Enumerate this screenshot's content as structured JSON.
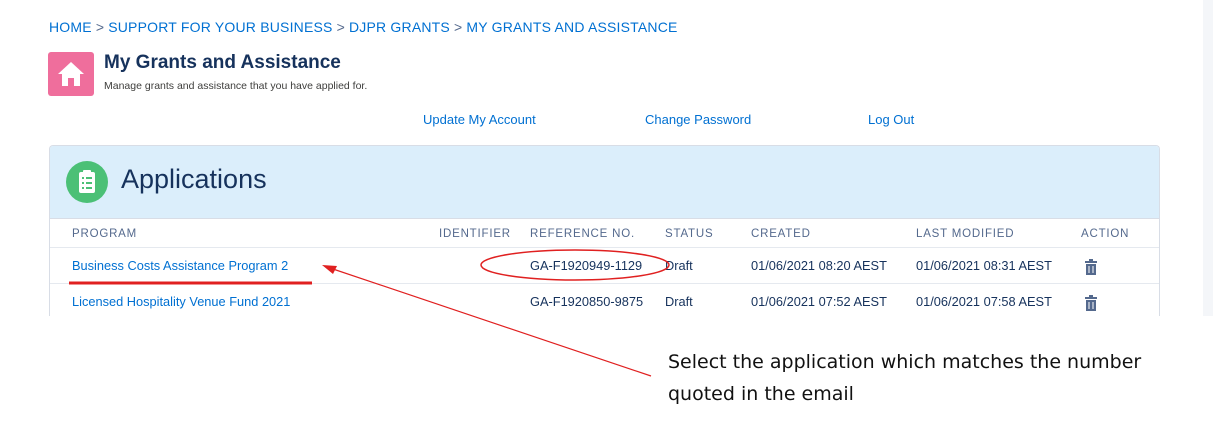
{
  "breadcrumb": {
    "items": [
      "HOME",
      "SUPPORT FOR YOUR BUSINESS",
      "DJPR GRANTS",
      "MY GRANTS AND ASSISTANCE"
    ],
    "separator": ">"
  },
  "page": {
    "icon": "home-icon",
    "title": "My Grants and Assistance",
    "subtitle": "Manage grants and assistance that you have applied for."
  },
  "account_links": {
    "update": "Update My Account",
    "password": "Change Password",
    "logout": "Log Out"
  },
  "applications": {
    "title": "Applications",
    "icon": "list-icon",
    "columns": [
      "PROGRAM",
      "IDENTIFIER",
      "REFERENCE NO.",
      "STATUS",
      "CREATED",
      "LAST MODIFIED",
      "ACTION"
    ],
    "rows": [
      {
        "program": "Business Costs Assistance Program 2",
        "identifier": "",
        "reference": "GA-F1920949-1129",
        "status": "Draft",
        "created": "01/06/2021 08:20 AEST",
        "modified": "01/06/2021 08:31 AEST",
        "action_icon": "trash-icon"
      },
      {
        "program": "Licensed Hospitality Venue Fund 2021",
        "identifier": "",
        "reference": "GA-F1920850-9875",
        "status": "Draft",
        "created": "01/06/2021 07:52 AEST",
        "modified": "01/06/2021 07:58 AEST",
        "action_icon": "trash-icon"
      }
    ]
  },
  "annotation": {
    "text": "Select the application which matches the number quoted in the email",
    "color": "#e02020"
  },
  "colors": {
    "link": "#0070d2",
    "header_bg": "#dbeefb",
    "home_icon_bg": "#ef6e9c",
    "list_icon_bg": "#4bc076"
  }
}
